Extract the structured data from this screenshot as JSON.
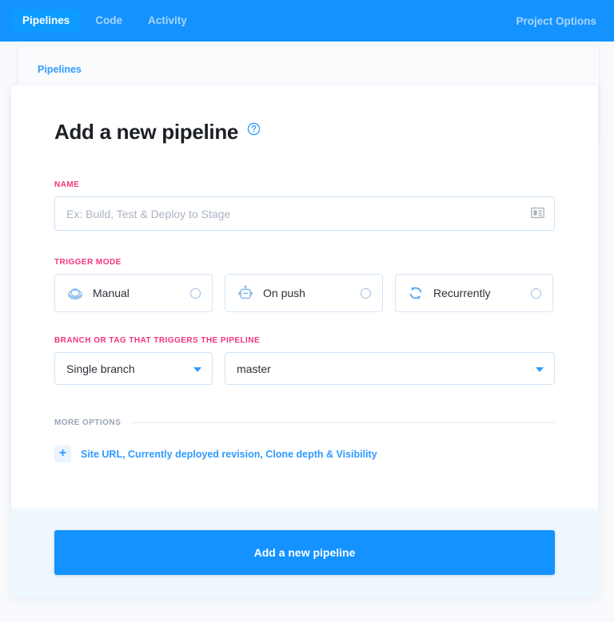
{
  "topnav": {
    "tabs": [
      {
        "label": "Pipelines",
        "active": true
      },
      {
        "label": "Code",
        "active": false
      },
      {
        "label": "Activity",
        "active": false
      }
    ],
    "right_link": "Project Options"
  },
  "breadcrumb": {
    "items": [
      "Pipelines"
    ]
  },
  "form": {
    "title": "Add a new pipeline",
    "help_icon": "question-circle-icon",
    "name": {
      "label": "NAME",
      "placeholder": "Ex: Build, Test & Deploy to Stage",
      "value": "",
      "trailing_icon": "id-card-icon"
    },
    "trigger_mode": {
      "label": "TRIGGER MODE",
      "options": [
        {
          "label": "Manual",
          "icon": "hand-icon",
          "selected": false
        },
        {
          "label": "On push",
          "icon": "robot-icon",
          "selected": false
        },
        {
          "label": "Recurrently",
          "icon": "refresh-cycle-icon",
          "selected": false
        }
      ]
    },
    "branch": {
      "label": "BRANCH OR TAG THAT TRIGGERS THE PIPELINE",
      "scope_value": "Single branch",
      "branch_value": "master"
    },
    "more_options": {
      "label": "MORE OPTIONS",
      "toggle_icon": "plus-icon",
      "link_text": "Site URL, Currently deployed revision, Clone depth & Visibility"
    }
  },
  "footer": {
    "submit_label": "Add a new pipeline"
  },
  "colors": {
    "brand_blue": "#1492ff",
    "accent_pink": "#f2347d",
    "link_blue": "#2f9bff",
    "footer_bg": "#eef7fd"
  }
}
